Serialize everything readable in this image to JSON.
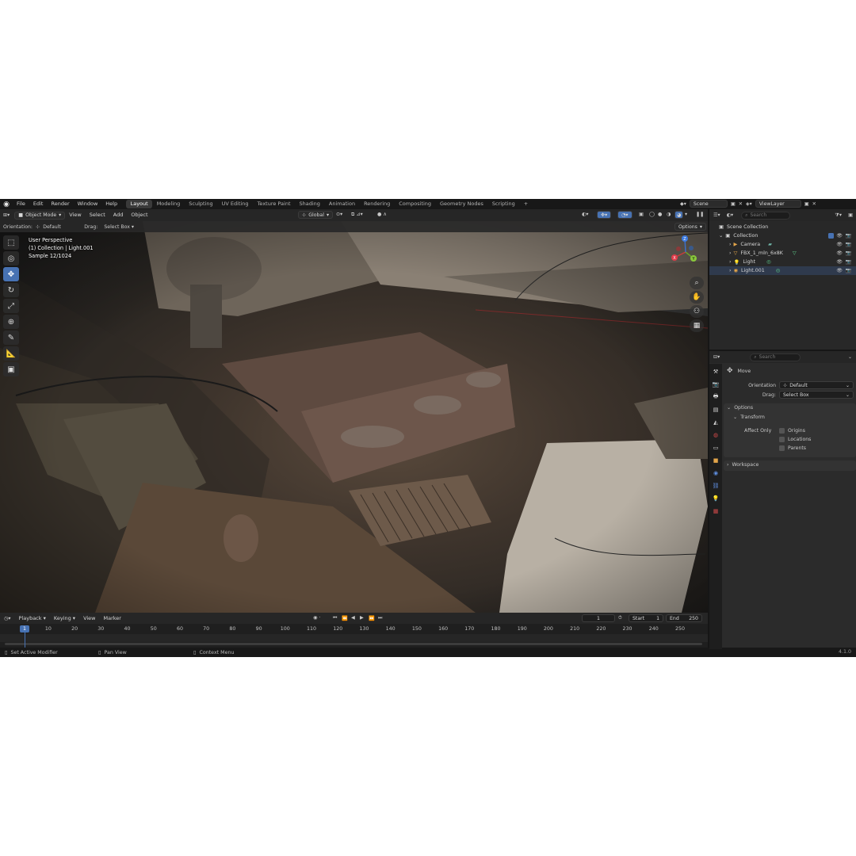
{
  "menu": [
    "File",
    "Edit",
    "Render",
    "Window",
    "Help"
  ],
  "workspaces": [
    "Layout",
    "Modeling",
    "Sculpting",
    "UV Editing",
    "Texture Paint",
    "Shading",
    "Animation",
    "Rendering",
    "Compositing",
    "Geometry Nodes",
    "Scripting"
  ],
  "scene": {
    "name": "Scene",
    "view_layer": "ViewLayer"
  },
  "viewport_header": {
    "mode": "Object Mode",
    "menus": [
      "View",
      "Select",
      "Add",
      "Object"
    ],
    "transform_orientation": "Global",
    "options": "Options"
  },
  "tool_header": {
    "orientation_label": "Orientation:",
    "orientation_value": "Default",
    "drag_label": "Drag:",
    "drag_value": "Select Box"
  },
  "viewport_overlay": {
    "line1": "User Perspective",
    "line2": "(1) Collection | Light.001",
    "line3": "Sample 12/1024"
  },
  "gizmo": {
    "x": "X",
    "y": "Y",
    "z": "Z"
  },
  "timeline": {
    "menus": [
      "Playback",
      "Keying",
      "View",
      "Marker"
    ],
    "current_frame": "1",
    "start_label": "Start",
    "start": "1",
    "end_label": "End",
    "end": "250",
    "ticks": [
      "10",
      "20",
      "30",
      "40",
      "50",
      "60",
      "70",
      "80",
      "90",
      "100",
      "110",
      "120",
      "130",
      "140",
      "150",
      "160",
      "170",
      "180",
      "190",
      "200",
      "210",
      "220",
      "230",
      "240",
      "250"
    ],
    "cursor_label": "1"
  },
  "statusbar": {
    "left": "Set Active Modifier",
    "middle": "Pan View",
    "right": "Context Menu",
    "version": "4.1.0"
  },
  "outliner": {
    "search_placeholder": "Search",
    "scene_collection": "Scene Collection",
    "collection": "Collection",
    "items": [
      "Camera",
      "FBX_1_mln_6x8K",
      "Light",
      "Light.001"
    ]
  },
  "properties": {
    "search_placeholder": "Search",
    "tool_name": "Move",
    "orientation_label": "Orientation",
    "orientation_value": "Default",
    "drag_label": "Drag:",
    "drag_value": "Select Box",
    "options_title": "Options",
    "transform_title": "Transform",
    "affect_only_label": "Affect Only",
    "affect_options": [
      "Origins",
      "Locations",
      "Parents"
    ],
    "workspace_title": "Workspace"
  },
  "colors": {
    "accent": "#4772b3",
    "background": "#1d1d1d",
    "panel": "#2b2b2b"
  }
}
